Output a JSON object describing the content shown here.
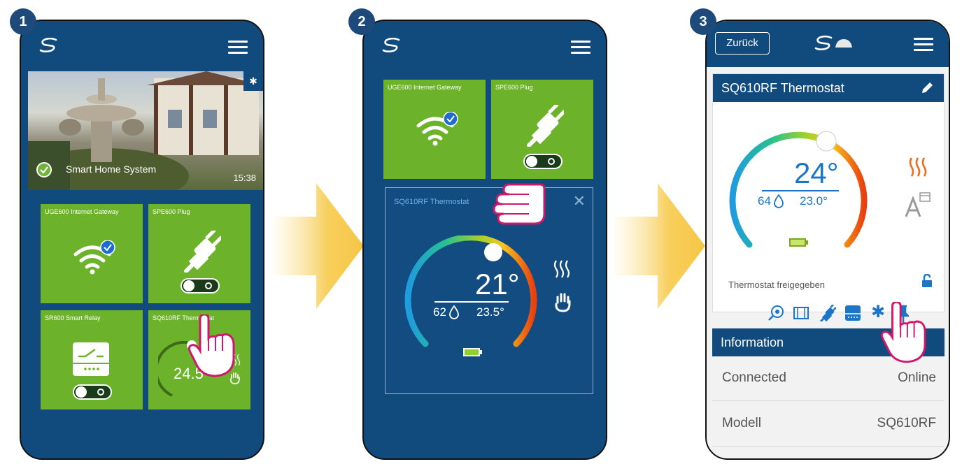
{
  "steps": [
    "1",
    "2",
    "3"
  ],
  "screen1": {
    "home": {
      "name": "Smart Home System",
      "time": "15:38"
    },
    "tiles": [
      {
        "label": "UGE600 Internet Gateway"
      },
      {
        "label": "SPE600 Plug"
      },
      {
        "label": "SR600 Smart Relay"
      },
      {
        "label": "SQ610RF Thermostat",
        "temperature": "24.5°"
      }
    ]
  },
  "screen2": {
    "tiles": [
      {
        "label": "UGE600 Internet Gateway"
      },
      {
        "label": "SPE600 Plug"
      }
    ],
    "thermostat": {
      "label": "SQ610RF Thermostat",
      "setpoint": "21°",
      "humidity": "62",
      "current": "23.5°"
    }
  },
  "screen3": {
    "back_label": "Zurück",
    "card_title": "SQ610RF Thermostat",
    "setpoint": "24°",
    "humidity": "64",
    "current": "23.0°",
    "status_text": "Thermostat freigegeben",
    "info_title": "Information",
    "info_rows": [
      {
        "key": "Connected",
        "value": "Online"
      },
      {
        "key": "Modell",
        "value": "SQ610RF"
      }
    ]
  },
  "colors": {
    "navy": "#114a7d",
    "tile_green": "#6cb22a",
    "badge": "#1d4a7a",
    "arrow": "#f7c84a",
    "hand_pink": "#d1176b",
    "heat_orange": "#f26a1b"
  }
}
